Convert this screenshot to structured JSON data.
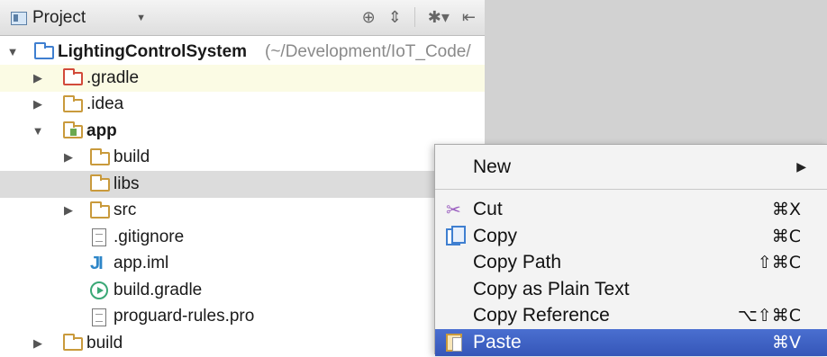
{
  "toolwindow": {
    "selector_label": "Project",
    "tools": [
      "⊕",
      "⇕",
      "✱▾",
      "⇤"
    ]
  },
  "tree": {
    "root_name": "LightingControlSystem",
    "root_path": "(~/Development/IoT_Code/",
    "gradle": ".gradle",
    "idea": ".idea",
    "app": "app",
    "build": "build",
    "libs": "libs",
    "src": "src",
    "gitignore": ".gitignore",
    "app_iml": "app.iml",
    "build_gradle": "build.gradle",
    "proguard": "proguard-rules.pro",
    "build_root": "build"
  },
  "context_menu": {
    "new": "New",
    "cut": "Cut",
    "cut_shortcut": "⌘X",
    "copy": "Copy",
    "copy_shortcut": "⌘C",
    "copy_path": "Copy Path",
    "copy_path_shortcut": "⇧⌘C",
    "copy_plain": "Copy as Plain Text",
    "copy_reference": "Copy Reference",
    "copy_reference_shortcut": "⌥⇧⌘C",
    "paste": "Paste",
    "paste_shortcut": "⌘V"
  },
  "colors": {
    "selection": "#3a5cc0",
    "row_highlight_yellow": "#fbfbe4",
    "row_highlight_grey": "#dcdcdc",
    "folder": "#c99a3c"
  }
}
